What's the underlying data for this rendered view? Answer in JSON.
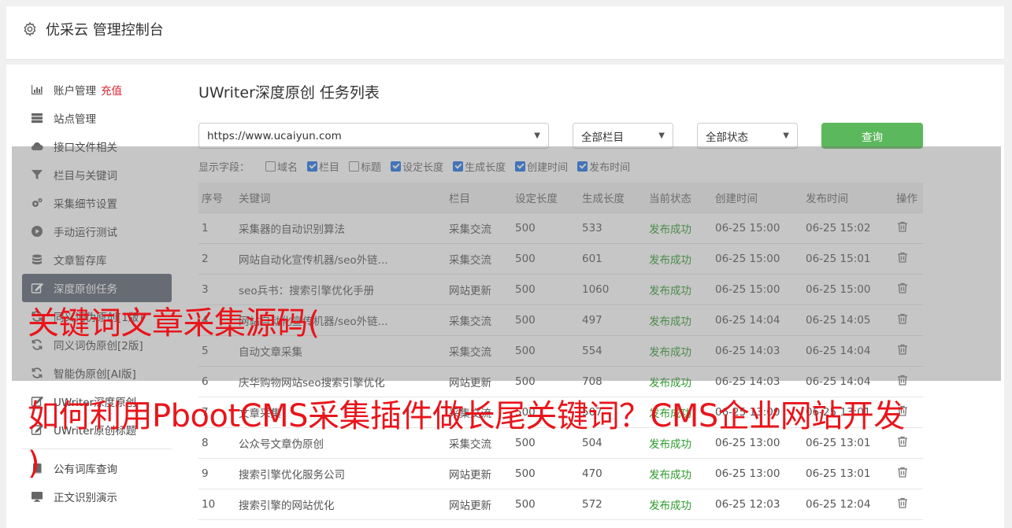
{
  "header": {
    "title": "优采云 管理控制台"
  },
  "sidebar": {
    "items": [
      {
        "label": "账户管理",
        "extra": "充值",
        "icon": "bar-chart-icon"
      },
      {
        "label": "站点管理",
        "icon": "server-icon"
      },
      {
        "label": "接口文件相关",
        "icon": "cloud-icon"
      },
      {
        "label": "栏目与关键词",
        "icon": "filter-icon"
      },
      {
        "label": "采集细节设置",
        "icon": "gears-icon"
      },
      {
        "label": "手动运行测试",
        "icon": "play-icon"
      },
      {
        "label": "文章暂存库",
        "icon": "database-icon"
      },
      {
        "label": "深度原创任务",
        "icon": "edit-icon",
        "active": true
      },
      {
        "label": "同义词伪原创[1版]",
        "icon": "refresh-icon"
      },
      {
        "label": "同义词伪原创[2版]",
        "icon": "refresh-icon"
      },
      {
        "label": "智能伪原创[AI版]",
        "icon": "refresh-icon"
      },
      {
        "label": "UWriter深度原创",
        "icon": "edit-icon"
      },
      {
        "label": "UWriter原创标题",
        "icon": "edit-icon"
      },
      {
        "label": "公有词库查询",
        "icon": "book-icon"
      },
      {
        "label": "正文识别演示",
        "icon": "monitor-icon"
      }
    ]
  },
  "main": {
    "title": "UWriter深度原创 任务列表",
    "filters": {
      "site": "https://www.ucaiyun.com",
      "column": "全部栏目",
      "status": "全部状态",
      "query_label": "查询"
    },
    "fields": {
      "label": "显示字段：",
      "options": [
        {
          "label": "域名",
          "checked": false
        },
        {
          "label": "栏目",
          "checked": true
        },
        {
          "label": "标题",
          "checked": false
        },
        {
          "label": "设定长度",
          "checked": true
        },
        {
          "label": "生成长度",
          "checked": true
        },
        {
          "label": "创建时间",
          "checked": true
        },
        {
          "label": "发布时间",
          "checked": true
        }
      ]
    },
    "table": {
      "headers": [
        "序号",
        "关键词",
        "栏目",
        "设定长度",
        "生成长度",
        "当前状态",
        "创建时间",
        "发布时间",
        "操作"
      ],
      "rows": [
        [
          "1",
          "采集器的自动识别算法",
          "采集交流",
          "500",
          "533",
          "发布成功",
          "06-25 15:00",
          "06-25 15:02"
        ],
        [
          "2",
          "网站自动化宣传机器/seo外链...",
          "采集交流",
          "500",
          "601",
          "发布成功",
          "06-25 15:00",
          "06-25 15:01"
        ],
        [
          "3",
          "seo兵书：搜索引擎优化手册",
          "网站更新",
          "500",
          "1060",
          "发布成功",
          "06-25 15:00",
          "06-25 15:00"
        ],
        [
          "4",
          "网站自动化宣传机器/seo外链...",
          "采集交流",
          "500",
          "497",
          "发布成功",
          "06-25 14:04",
          "06-25 14:05"
        ],
        [
          "5",
          "自动文章采集",
          "采集交流",
          "500",
          "554",
          "发布成功",
          "06-25 14:03",
          "06-25 14:04"
        ],
        [
          "6",
          "庆华购物网站seo搜索引擎优化",
          "网站更新",
          "500",
          "708",
          "发布成功",
          "06-25 14:03",
          "06-25 14:04"
        ],
        [
          "7",
          "文章采集",
          "采集交流",
          "500",
          "507",
          "发布成功",
          "06-25 13:00",
          "06-25 13:01"
        ],
        [
          "8",
          "公众号文章伪原创",
          "采集交流",
          "500",
          "504",
          "发布成功",
          "06-25 13:00",
          "06-25 13:01"
        ],
        [
          "9",
          "搜索引擎优化服务公司",
          "网站更新",
          "500",
          "470",
          "发布成功",
          "06-25 13:00",
          "06-25 13:01"
        ],
        [
          "10",
          "搜索引擎的网站优化",
          "网站更新",
          "500",
          "572",
          "发布成功",
          "06-25 12:03",
          "06-25 12:04"
        ]
      ]
    }
  },
  "overlay": {
    "line1": "关键词文章采集源码(",
    "line2": "如何利用PbootCMS采集插件做长尾关键词？CMS企业网站开发",
    "line3": ")"
  },
  "colors": {
    "accent_green": "#5cb85c",
    "active_bg": "#5c6270",
    "success": "#2e9a2e",
    "overlay_text": "#e8151b"
  }
}
